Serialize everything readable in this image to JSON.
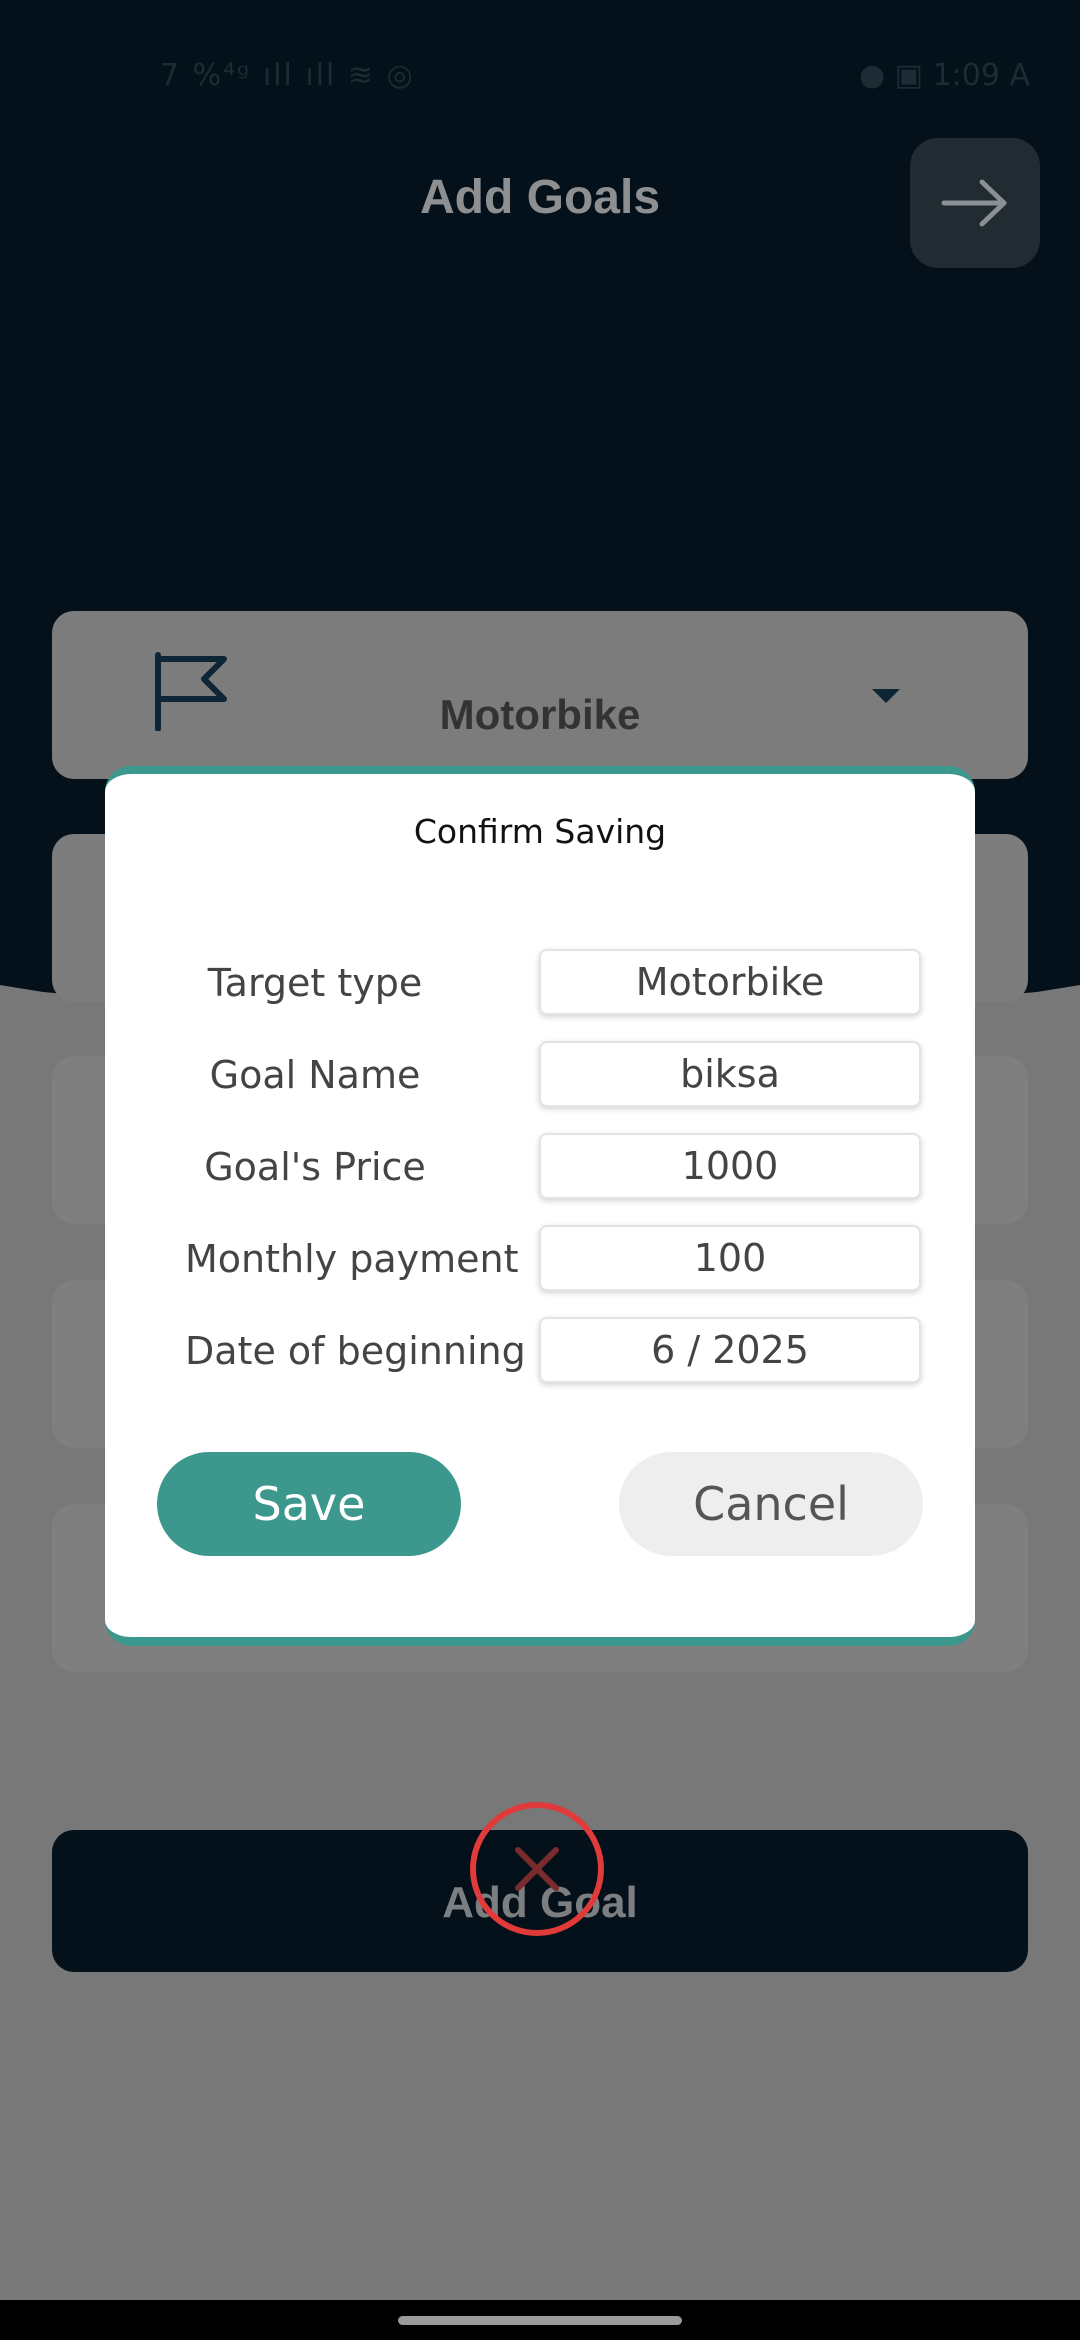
{
  "status_bar": {
    "left_icons": "7 %⁴ᵍ ıll ıll ≋ ◎",
    "right_text": "● ▣ 1:09 A"
  },
  "header": {
    "title": "Add Goals",
    "next_icon": "arrow-right-icon"
  },
  "form": {
    "target_type_selected": "Motorbike",
    "flag_icon": "flag-icon",
    "dropdown_icon": "caret-down-icon"
  },
  "add_goal_button": {
    "label": "Add Goal"
  },
  "dialog": {
    "title": "Confirm Saving",
    "rows": [
      {
        "label": "Target type",
        "value": "Motorbike"
      },
      {
        "label": "Goal Name",
        "value": "biksa"
      },
      {
        "label": "Goal's Price",
        "value": "1000"
      },
      {
        "label": "Monthly payment",
        "value": "100"
      },
      {
        "label": "Date of beginning",
        "value": "6 / 2025"
      }
    ],
    "save_label": "Save",
    "cancel_label": "Cancel",
    "accent_color": "#3c978d"
  },
  "overlay": {
    "close_icon": "close-x-icon",
    "color": "#e03a3a"
  }
}
